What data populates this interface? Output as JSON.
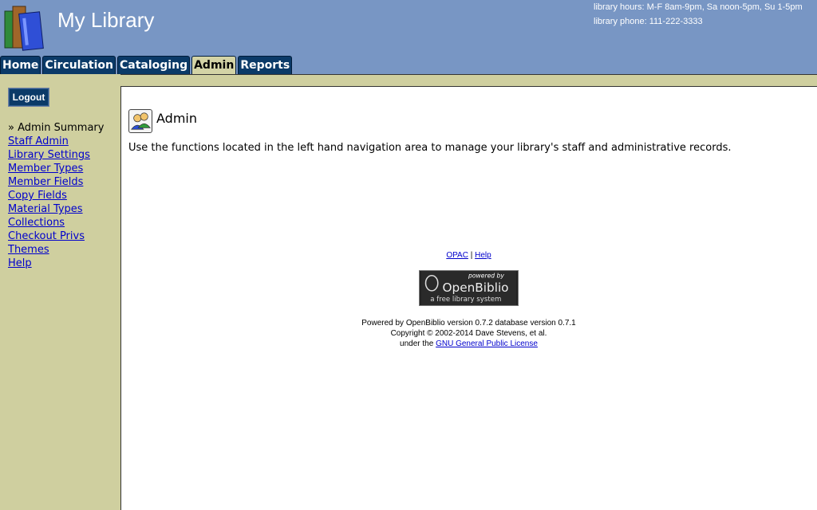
{
  "header": {
    "title": "My Library",
    "hours": "library hours:  M-F 8am-9pm, Sa noon-5pm, Su 1-5pm",
    "phone": "library phone: 111-222-3333"
  },
  "tabs": [
    {
      "label": "Home"
    },
    {
      "label": "Circulation"
    },
    {
      "label": "Cataloging"
    },
    {
      "label": "Admin",
      "active": true
    },
    {
      "label": "Reports"
    }
  ],
  "sidebar": {
    "logout_label": "Logout",
    "current": "» Admin Summary",
    "items": [
      {
        "label": "Staff Admin"
      },
      {
        "label": "Library Settings"
      },
      {
        "label": "Member Types"
      },
      {
        "label": "Member Fields"
      },
      {
        "label": "Copy Fields"
      },
      {
        "label": "Material Types"
      },
      {
        "label": "Collections"
      },
      {
        "label": "Checkout Privs"
      },
      {
        "label": "Themes"
      },
      {
        "label": "Help"
      }
    ]
  },
  "main": {
    "title": "Admin",
    "description": "Use the functions located in the left hand navigation area to manage your library's staff and administrative records."
  },
  "footer": {
    "opac_label": "OPAC",
    "separator": "|",
    "help_label": "Help",
    "badge_top": "powered by",
    "badge_name": "OpenBiblio",
    "badge_tagline": "a free library system",
    "powered_line": "Powered by OpenBiblio version 0.7.2 database version 0.7.1",
    "copyright_line": "Copyright © 2002-2014 Dave Stevens, et al.",
    "license_prefix": "under the",
    "license_link": "GNU General Public License"
  },
  "colors": {
    "header_bg": "#7896c4",
    "tab_bg": "#0b3a68",
    "tab_active_bg": "#d3d3a6",
    "sidebar_bg": "#cfcf9f",
    "link": "#0000cc"
  }
}
